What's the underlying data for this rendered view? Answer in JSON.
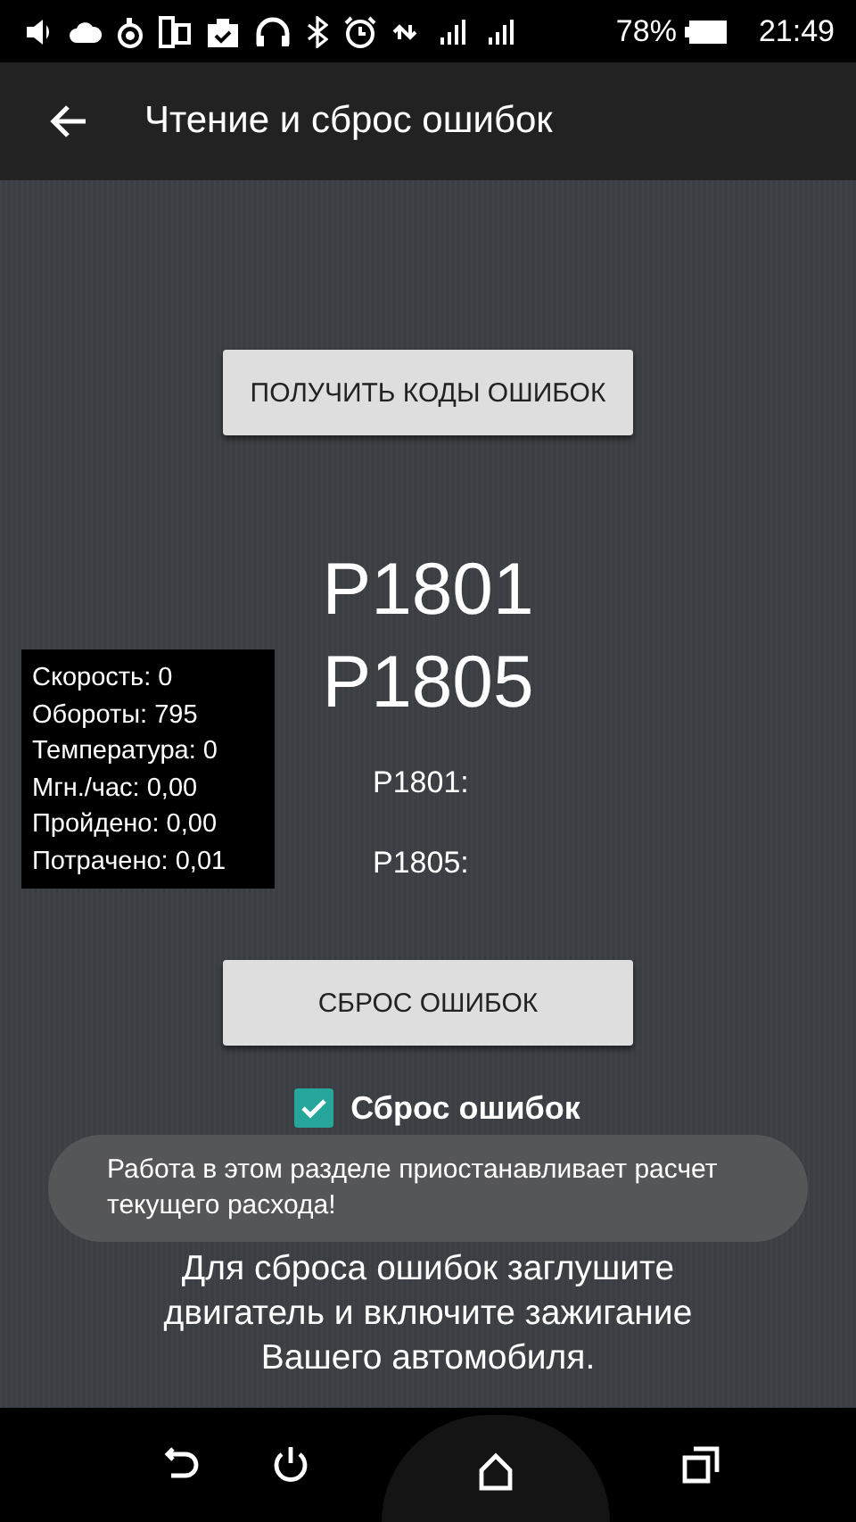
{
  "status_bar": {
    "battery": "78%",
    "time": "21:49"
  },
  "app_bar": {
    "title": "Чтение и сброс ошибок"
  },
  "read_button": {
    "label": "ПОЛУЧИТЬ КОДЫ ОШИБОК"
  },
  "codes": [
    "P1801",
    "P1805"
  ],
  "code_details": [
    {
      "label": "P1801:"
    },
    {
      "label": "P1805:"
    }
  ],
  "stats": [
    "Скорость: 0",
    "Обороты: 795",
    "Температура: 0",
    "Мгн./час: 0,00",
    "Пройдено: 0,00",
    "Потрачено: 0,01"
  ],
  "reset_button": {
    "label": "СБРОС ОШИБОК"
  },
  "reset_checkbox": {
    "label": "Сброс ошибок",
    "checked": true
  },
  "instruction": "Для сброса ошибок заглушите двигатель и включите зажигание Вашего автомобиля.",
  "toast": "Работа в этом разделе приостанавливает расчет текущего расхода!"
}
